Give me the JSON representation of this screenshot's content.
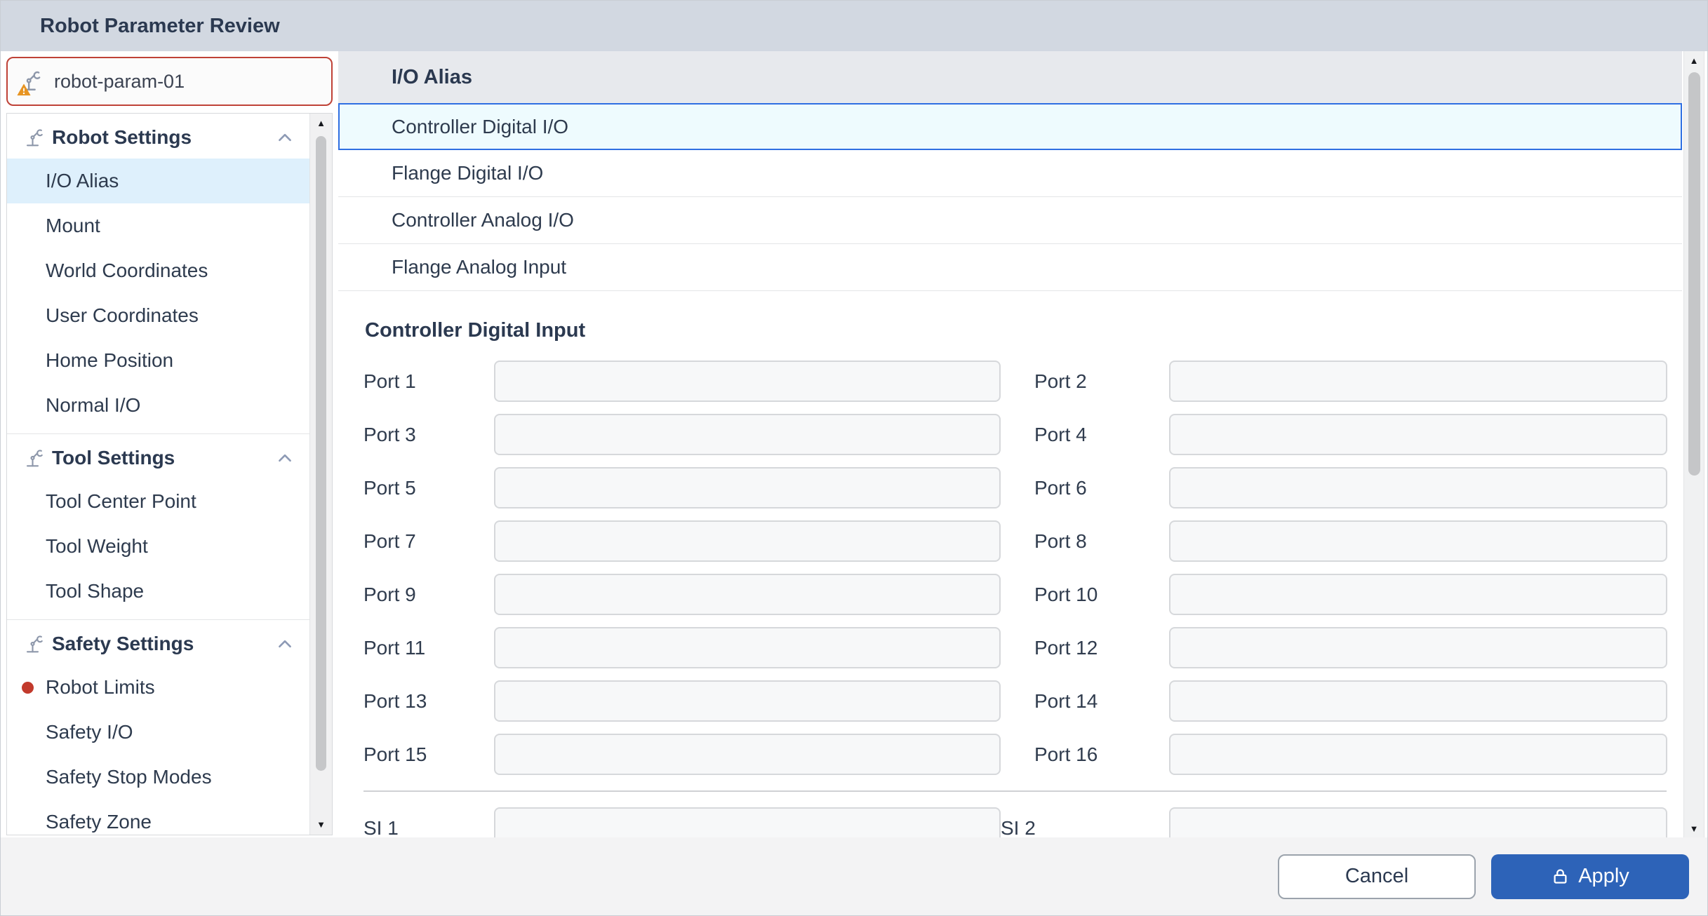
{
  "dialog": {
    "title": "Robot Parameter Review"
  },
  "sidebar": {
    "robot_name_field": {
      "value": "robot-param-01",
      "placeholder": "",
      "icon": "robot-arm-warning-icon"
    },
    "sections": [
      {
        "label": "Robot Settings",
        "icon": "robot-arm-icon",
        "collapse_icon": "chevron-up-icon",
        "items": [
          {
            "label": "I/O Alias",
            "selected": true
          },
          {
            "label": "Mount"
          },
          {
            "label": "World Coordinates"
          },
          {
            "label": "User Coordinates"
          },
          {
            "label": "Home Position"
          },
          {
            "label": "Normal I/O"
          }
        ]
      },
      {
        "label": "Tool Settings",
        "icon": "robot-arm-icon",
        "collapse_icon": "chevron-up-icon",
        "items": [
          {
            "label": "Tool Center Point"
          },
          {
            "label": "Tool Weight"
          },
          {
            "label": "Tool Shape"
          }
        ]
      },
      {
        "label": "Safety Settings",
        "icon": "robot-arm-icon",
        "collapse_icon": "chevron-up-icon",
        "items": [
          {
            "label": "Robot Limits",
            "alert": true,
            "alert_icon": "red-dot-icon"
          },
          {
            "label": "Safety I/O"
          },
          {
            "label": "Safety Stop Modes"
          },
          {
            "label": "Safety Zone"
          }
        ]
      }
    ]
  },
  "main": {
    "list": {
      "header": "I/O Alias",
      "items": [
        {
          "label": "Controller Digital I/O",
          "selected": true
        },
        {
          "label": "Flange Digital I/O"
        },
        {
          "label": "Controller Analog I/O"
        },
        {
          "label": "Flange Analog Input"
        }
      ]
    },
    "section_title": "Controller Digital Input",
    "ports": [
      "Port 1",
      "Port 2",
      "Port 3",
      "Port 4",
      "Port 5",
      "Port 6",
      "Port 7",
      "Port 8",
      "Port 9",
      "Port 10",
      "Port 11",
      "Port 12",
      "Port 13",
      "Port 14",
      "Port 15",
      "Port 16"
    ],
    "si_ports": [
      "SI 1",
      "SI 2"
    ],
    "port_input_value": "",
    "port_input_placeholder": ""
  },
  "footer": {
    "cancel_label": "Cancel",
    "apply_label": "Apply",
    "apply_icon": "lock-icon"
  },
  "icons": {
    "scroll_up_glyph": "▲",
    "scroll_down_glyph": "▼"
  },
  "colors": {
    "titlebar_bg": "#d2d8e1",
    "title_text": "#2b3950",
    "name_field_error_border": "#bf4237",
    "warning_icon": "#e79422",
    "sidebar_selected_bg": "#def0fc",
    "alert_dot": "#c23a2c",
    "list_header_bg": "#e7e9ed",
    "selected_row_bg": "#eefbfe",
    "selected_row_border": "#2f6fe2",
    "input_bg": "#f7f8f9",
    "footer_bg": "#f3f3f4",
    "apply_button_bg": "#2d63b8"
  }
}
